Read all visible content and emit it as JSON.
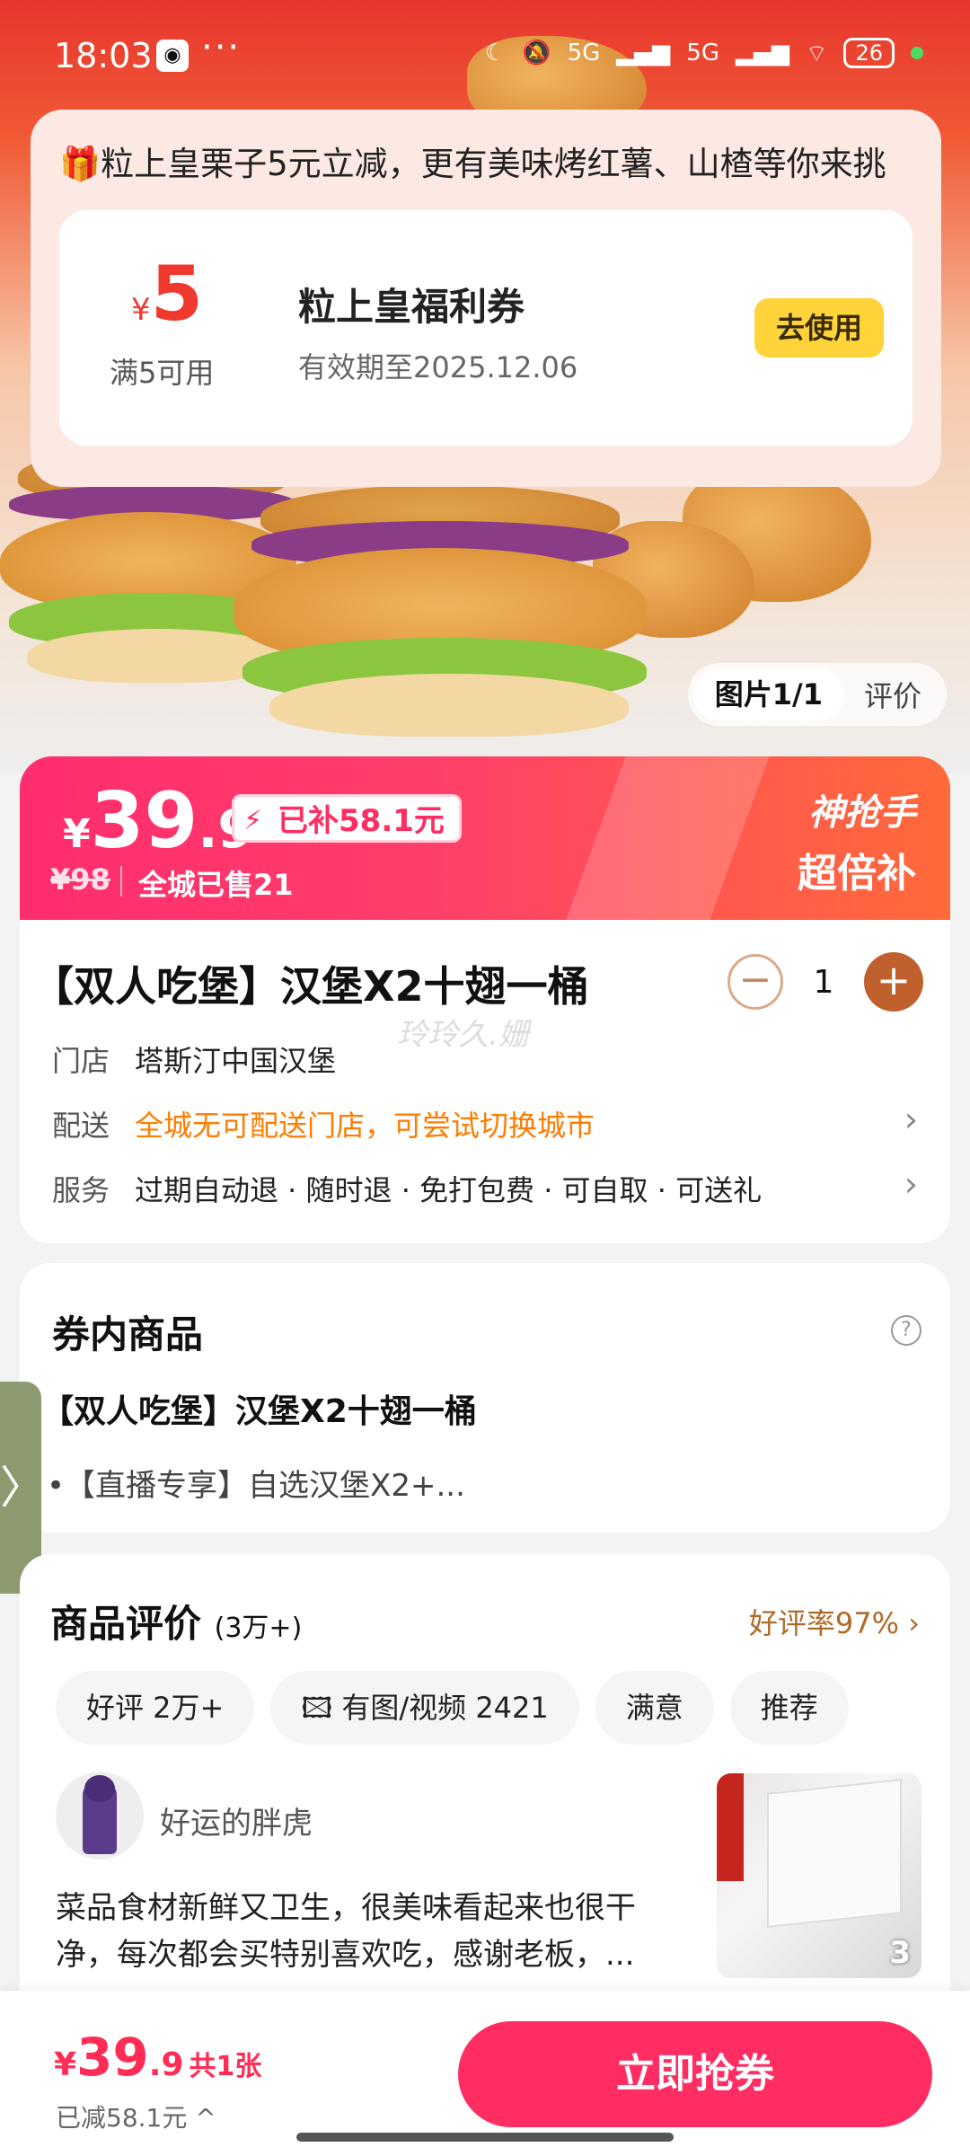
{
  "status_bar": {
    "time": "18:03",
    "more": "···",
    "network_1": "5G",
    "network_2": "5G",
    "battery": "26"
  },
  "coupon_promo": {
    "headline": "🎁粒上皇栗子5元立减，更有美味烤红薯、山楂等你来挑",
    "currency": "¥",
    "amount": "5",
    "condition": "满5可用",
    "title": "粒上皇福利券",
    "validity": "有效期至2025.12.06",
    "use_button": "去使用"
  },
  "image_pager": {
    "current": "图片1/1",
    "reviews_tab": "评价"
  },
  "price_banner": {
    "currency": "¥",
    "price_int": "39",
    "price_dec": ".9",
    "subsidy": "已补58.1元",
    "original_price": "¥98",
    "sold": "全城已售21",
    "tag_1": "神抢手",
    "tag_2": "超倍补"
  },
  "product": {
    "title": "【双人吃堡】汉堡X2十翅一桶",
    "quantity": "1",
    "watermark": "玲玲久.姗",
    "store_label": "门店",
    "store_value": "塔斯汀中国汉堡",
    "delivery_label": "配送",
    "delivery_value": "全城无可配送门店，可尝试切换城市",
    "service_label": "服务",
    "service_value": "过期自动退 · 随时退 · 免打包费 · 可自取 · 可送礼"
  },
  "voucher_contents": {
    "title": "券内商品",
    "item": "【双人吃堡】汉堡X2十翅一桶",
    "sub_item": "•【直播专享】自选汉堡X2+..."
  },
  "reviews": {
    "title": "商品评价",
    "count": "(3万+)",
    "good_rate": "好评率97%",
    "chips": [
      "好评 2万+",
      "有图/视频 2421",
      "满意",
      "推荐"
    ],
    "reviewer": "好运的胖虎",
    "text": "菜品食材新鲜又卫生，很美味看起来也很干净，每次都会买特别喜欢吃，感谢老板，...",
    "image_count": "3"
  },
  "bottom_bar": {
    "currency": "¥",
    "price_int": "39",
    "price_dec": ".9",
    "count": "共1张",
    "saved": "已减58.1元 ^",
    "buy_button": "立即抢券"
  },
  "colors": {
    "accent_red": "#ff2d62",
    "coupon_red": "#f0382d",
    "use_button_yellow": "#ffd43a",
    "delivery_orange": "#ff7b00",
    "plus_brown": "#c0612d"
  }
}
